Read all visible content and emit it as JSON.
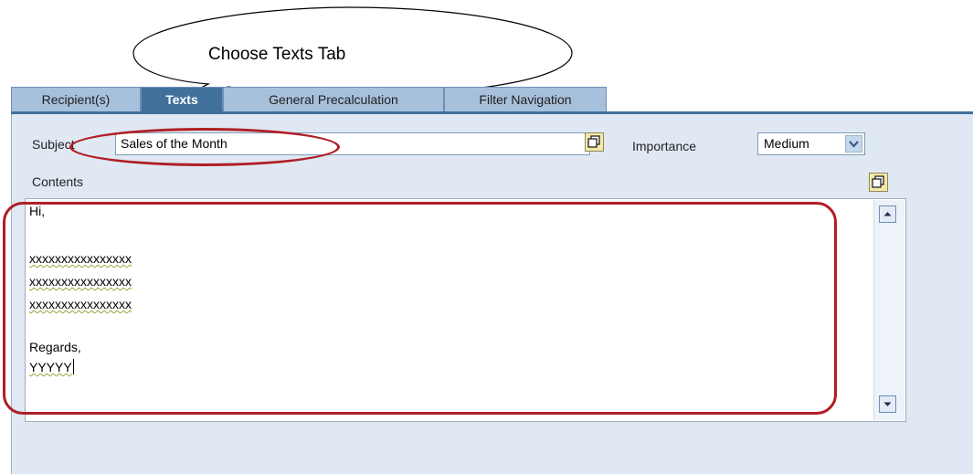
{
  "callout": {
    "text": "Choose Texts Tab"
  },
  "tabs": [
    {
      "label": "Recipient(s)",
      "active": false
    },
    {
      "label": "Texts",
      "active": true
    },
    {
      "label": "General Precalculation",
      "active": false
    },
    {
      "label": "Filter Navigation",
      "active": false
    }
  ],
  "form": {
    "subject_label": "Subject",
    "subject_value": "Sales of the Month",
    "importance_label": "Importance",
    "importance_value": "Medium",
    "contents_label": "Contents"
  },
  "contents": {
    "lines": [
      "Hi,",
      "",
      "xxxxxxxxxxxxxxxx",
      "xxxxxxxxxxxxxxxx",
      "xxxxxxxxxxxxxxxx",
      "",
      "Regards,",
      "YYYYY"
    ]
  },
  "colors": {
    "tab_active": "#41709d",
    "tab_inactive": "#a7c0dc",
    "panel": "#dfe8f3",
    "annotation": "#b01e24"
  },
  "icons": [
    "speech-bubble-callout",
    "expand-window-icon",
    "chevron-down-icon",
    "scroll-up-arrow-icon",
    "scroll-down-arrow-icon"
  ]
}
